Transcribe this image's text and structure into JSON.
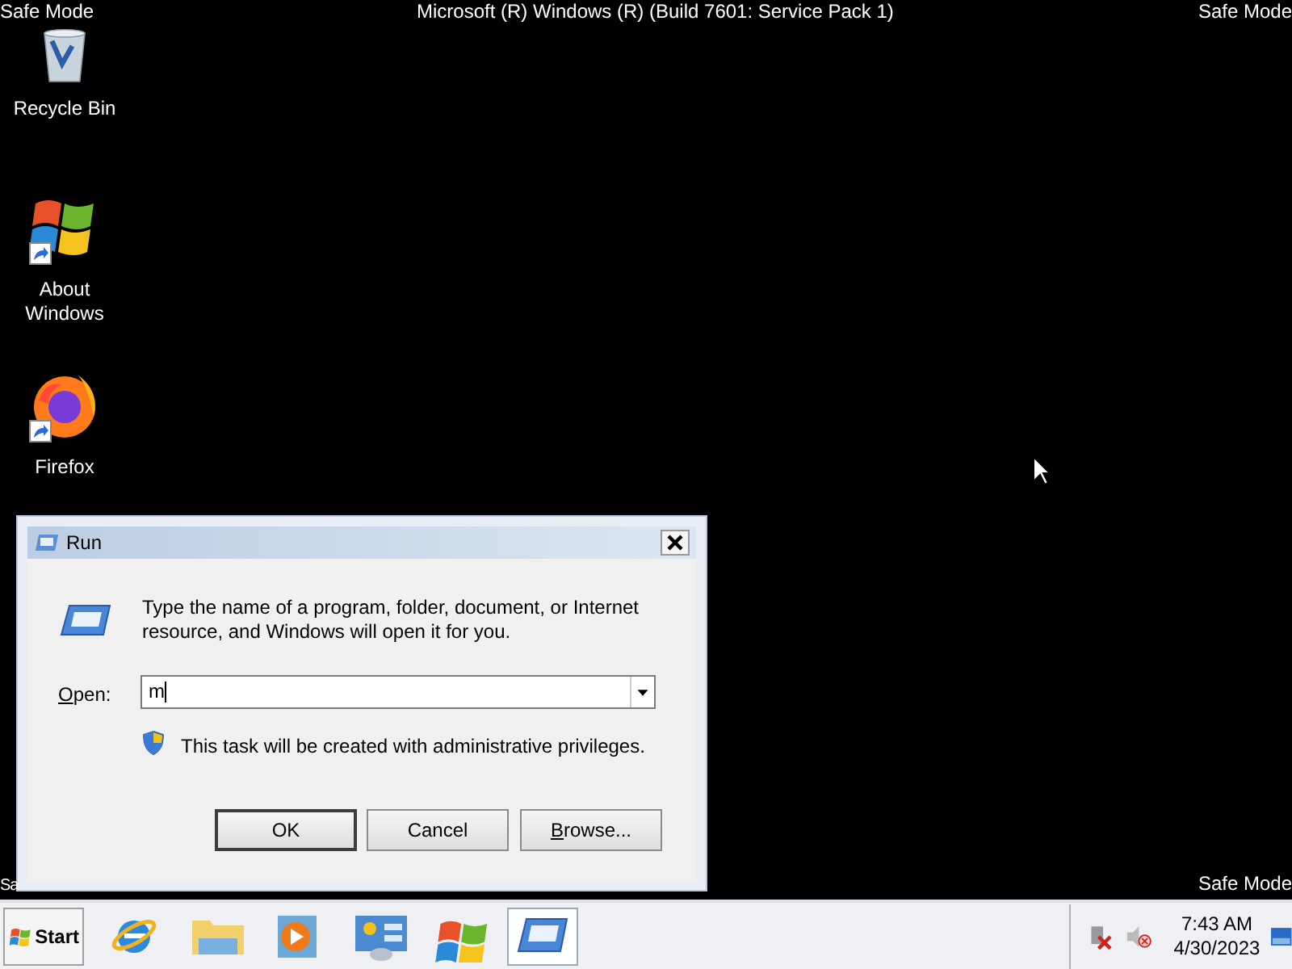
{
  "desktop": {
    "banner": "Microsoft (R) Windows (R) (Build 7601: Service Pack 1)",
    "corner_labels": [
      {
        "kind": "top-left",
        "text": "Safe Mode"
      },
      {
        "kind": "top-right",
        "text": "Safe Mode"
      },
      {
        "kind": "bottom-left",
        "text": "Sa"
      },
      {
        "kind": "bottom-right",
        "text": "Safe Mode"
      }
    ],
    "icons": [
      {
        "kind": "recycle",
        "label": "Recycle Bin",
        "shortcut": false
      },
      {
        "kind": "windows",
        "label": "About Windows",
        "shortcut": true
      },
      {
        "kind": "firefox",
        "label": "Firefox",
        "shortcut": true
      }
    ]
  },
  "dialog": {
    "title": "Run",
    "message": "Type the name of a program, folder, document, or Internet resource, and Windows will open it for you.",
    "open_label": "Open:",
    "value": "m",
    "note": "This task will be created with administrative privileges.",
    "buttons": [
      {
        "label": "OK",
        "default": true
      },
      {
        "label": "Cancel",
        "default": false
      },
      {
        "label": "Browse...",
        "default": false
      }
    ]
  },
  "taskbar": {
    "start": "Start",
    "items": [
      {
        "kind": "browser",
        "selected": false
      },
      {
        "kind": "folder",
        "selected": false
      },
      {
        "kind": "media",
        "selected": false
      },
      {
        "kind": "control",
        "selected": false
      },
      {
        "kind": "windows",
        "selected": false
      },
      {
        "kind": "run",
        "selected": true
      }
    ],
    "time": "7:43 AM",
    "date": "4/30/2023"
  }
}
